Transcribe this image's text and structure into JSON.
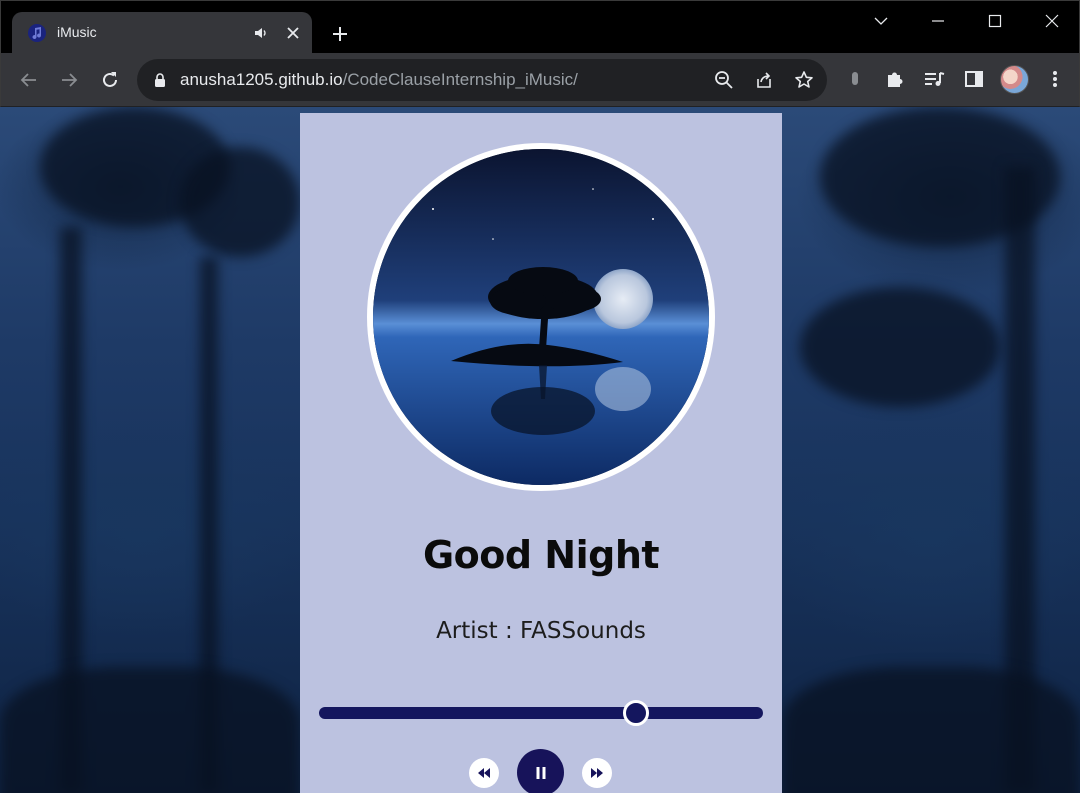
{
  "browser": {
    "tab": {
      "title": "iMusic",
      "favicon": "music-note-icon",
      "audio_icon": "speaker-icon",
      "close_icon": "close-icon"
    },
    "new_tab_icon": "plus-icon",
    "window_controls": [
      "chevron-down-icon",
      "minimize-icon",
      "maximize-icon",
      "close-icon"
    ],
    "url": {
      "host": "anusha1205.github.io",
      "path": "/CodeClauseInternship_iMusic/"
    },
    "toolbar_icons": [
      "zoom-out-icon",
      "share-icon",
      "bookmark-star-icon",
      "microphone-icon",
      "extensions-icon",
      "media-queue-icon",
      "side-panel-icon",
      "profile-avatar",
      "more-menu-icon"
    ]
  },
  "player": {
    "song_title": "Good Night",
    "artist": "Artist : FASSounds",
    "progress": 0.714,
    "controls": {
      "prev_icon": "rewind-icon",
      "play_icon": "pause-icon",
      "next_icon": "fast-forward-icon"
    },
    "colors": {
      "card": "#bcc2e0",
      "accent": "#14165e",
      "play_button": "#17135a"
    }
  }
}
